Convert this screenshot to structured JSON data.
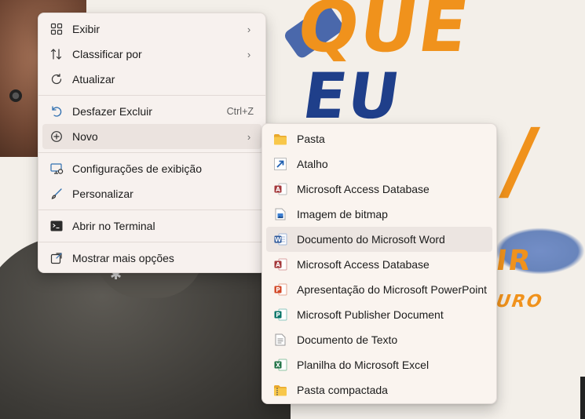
{
  "wallpaper": {
    "que": "QUE",
    "eufaco": "EU FAÇO",
    "slash": "/",
    "ir": "IR",
    "uro": "URO"
  },
  "context_menu": {
    "items": [
      {
        "label": "Exibir",
        "icon": "grid-icon",
        "submenu": true
      },
      {
        "label": "Classificar por",
        "icon": "sort-icon",
        "submenu": true
      },
      {
        "label": "Atualizar",
        "icon": "refresh-icon"
      },
      {
        "label": "Desfazer Excluir",
        "icon": "undo-icon",
        "shortcut": "Ctrl+Z"
      },
      {
        "label": "Novo",
        "icon": "plus-circle-icon",
        "submenu": true,
        "highlighted": true
      },
      {
        "label": "Configurações de exibição",
        "icon": "display-settings-icon"
      },
      {
        "label": "Personalizar",
        "icon": "brush-icon"
      },
      {
        "label": "Abrir no Terminal",
        "icon": "terminal-icon"
      },
      {
        "label": "Mostrar mais opções",
        "icon": "more-options-icon"
      }
    ]
  },
  "new_submenu": {
    "items": [
      {
        "label": "Pasta",
        "icon": "folder-icon"
      },
      {
        "label": "Atalho",
        "icon": "shortcut-icon"
      },
      {
        "label": "Microsoft Access Database",
        "icon": "access-icon"
      },
      {
        "label": "Imagem de bitmap",
        "icon": "bitmap-icon"
      },
      {
        "label": "Documento do Microsoft Word",
        "icon": "word-icon",
        "highlighted": true
      },
      {
        "label": "Microsoft Access Database",
        "icon": "access-icon"
      },
      {
        "label": "Apresentação do Microsoft PowerPoint",
        "icon": "powerpoint-icon"
      },
      {
        "label": "Microsoft Publisher Document",
        "icon": "publisher-icon"
      },
      {
        "label": "Documento de Texto",
        "icon": "text-document-icon"
      },
      {
        "label": "Planilha do Microsoft Excel",
        "icon": "excel-icon"
      },
      {
        "label": "Pasta compactada",
        "icon": "zip-folder-icon"
      }
    ]
  },
  "colors": {
    "menu_bg": "#f7f1ee",
    "hover_bg": "#ebe3df",
    "word_blue": "#2b579a",
    "excel_green": "#217346",
    "powerpoint_orange": "#d24726",
    "access_red": "#a4373a",
    "publisher_teal": "#077568",
    "folder_yellow": "#f8c74a"
  }
}
